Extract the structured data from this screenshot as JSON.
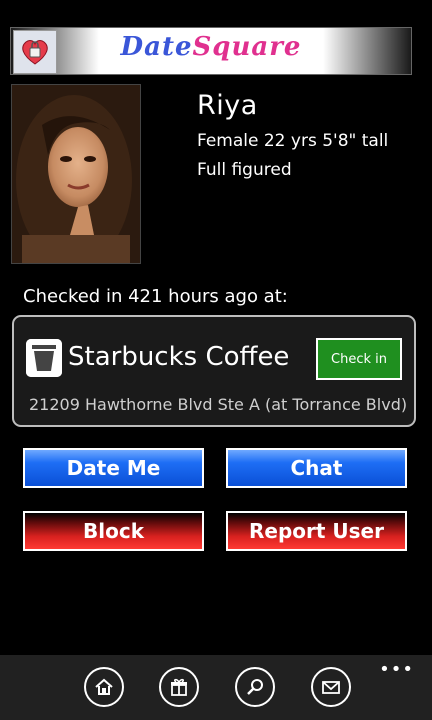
{
  "header": {
    "title_part1": "Date",
    "title_part2": "Square",
    "icon": "heart-lock-icon"
  },
  "profile": {
    "name": "Riya",
    "gender_age_height": "Female  22 yrs    5'8\" tall",
    "build": "Full figured",
    "photo_icon": "profile-photo"
  },
  "checkin": {
    "label": "Checked in 421 hours ago at:",
    "venue_name": "Starbucks Coffee",
    "venue_icon": "cup-icon",
    "address": "21209 Hawthorne Blvd Ste A (at Torrance Blvd)",
    "button_label": "Check in"
  },
  "actions": {
    "date_me": "Date Me",
    "chat": "Chat",
    "block": "Block",
    "report": "Report User"
  },
  "app_bar": {
    "icons": [
      "home-icon",
      "gift-icon",
      "search-icon",
      "mail-icon"
    ],
    "more": "•••"
  },
  "colors": {
    "accent_blue": "#1e6ef5",
    "accent_red": "#d8211f",
    "checkin_green": "#1f8f1f",
    "title_blue": "#3a56d8",
    "title_pink": "#e0308f"
  }
}
